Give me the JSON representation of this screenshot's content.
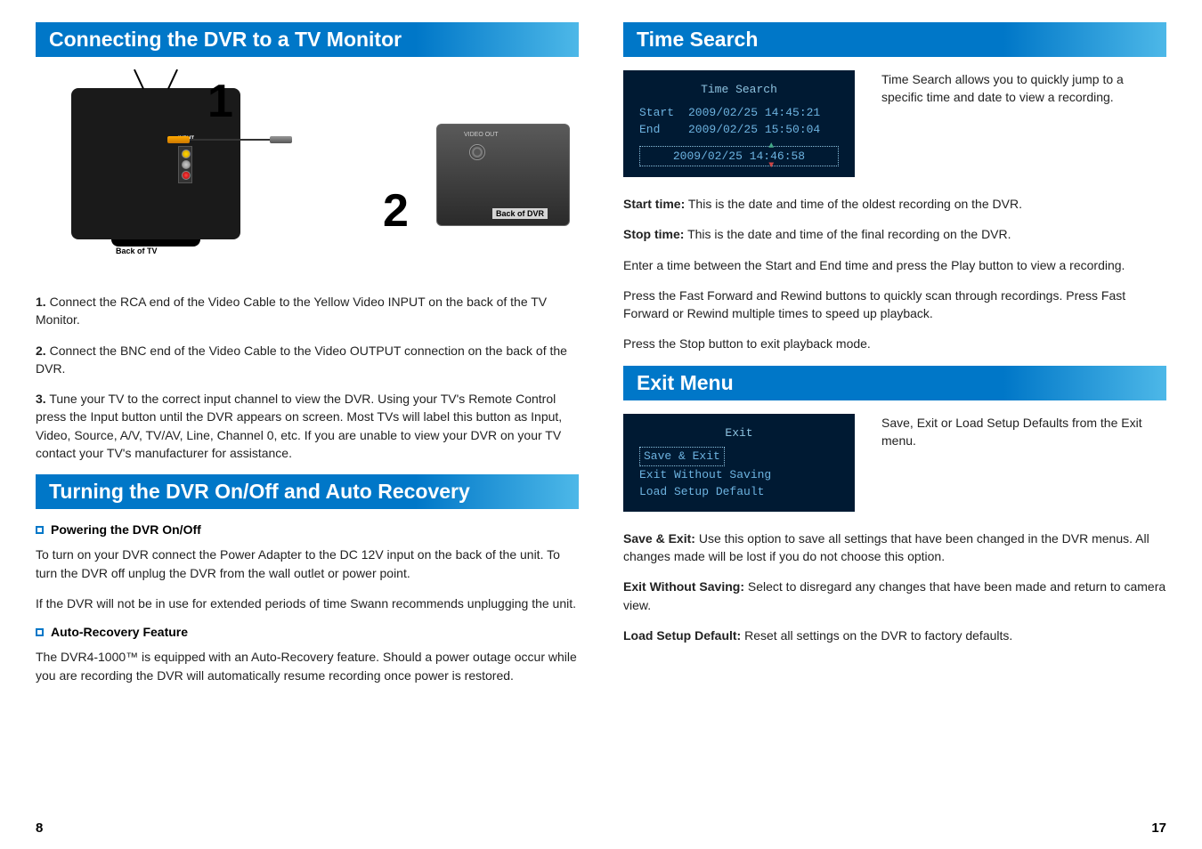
{
  "left": {
    "header1": "Connecting the DVR to a TV Monitor",
    "diagram": {
      "input_label": "INPUT",
      "back_tv": "Back of TV",
      "num1": "1",
      "num2": "2",
      "video_out": "VIDEO OUT",
      "back_dvr": "Back of DVR"
    },
    "step1_label": "1.",
    "step1": "Connect the RCA end of the Video Cable to the Yellow Video INPUT on the back of the TV Monitor.",
    "step2_label": "2.",
    "step2": "Connect the BNC end of the Video Cable to the Video OUTPUT connection on the back of the DVR.",
    "step3_label": "3.",
    "step3": "Tune your TV to the correct input channel to view the DVR.  Using your TV's Remote Control press the Input button until the DVR appears on screen.  Most TVs will label this button as Input, Video, Source, A/V, TV/AV, Line, Channel 0, etc.  If you are unable to view your DVR on your TV contact your TV's manufacturer for assistance.",
    "header2": "Turning the DVR On/Off and Auto Recovery",
    "sub1": "Powering the DVR On/Off",
    "p1": "To turn on your DVR connect the Power Adapter to the DC 12V input on the back of the unit.  To turn the DVR off unplug the DVR from the wall outlet or power point.",
    "p2": "If the DVR will not be in use for extended periods of time Swann recommends unplugging the unit.",
    "sub2": "Auto-Recovery Feature",
    "p3": "The DVR4-1000™ is equipped with an Auto-Recovery feature.  Should a power outage occur while you are recording the DVR will automatically resume recording once power is restored.",
    "page": "8"
  },
  "right": {
    "header1": "Time Search",
    "ts_shot": {
      "title": "Time Search",
      "start_l": "Start",
      "start_v": "2009/02/25 14:45:21",
      "end_l": "End",
      "end_v": "2009/02/25 15:50:04",
      "sel": "2009/02/25 14:46:58"
    },
    "ts_intro": "Time Search allows you to quickly jump to a specific time and date to view a recording.",
    "start_b": "Start time:",
    "start_t": "This is the date and time of the oldest recording on the DVR.",
    "stop_b": "Stop time:",
    "stop_t": "This is the date and time of the final recording on the DVR.",
    "enter": "Enter a time between the Start and End time and press the Play button to view a recording.",
    "ff": "Press the Fast Forward and Rewind buttons to quickly scan through recordings.  Press Fast Forward or Rewind multiple times to speed up playback.",
    "stop": "Press the Stop button to exit playback mode.",
    "header2": "Exit Menu",
    "ex_shot": {
      "title": "Exit",
      "i1": "Save & Exit",
      "i2": "Exit Without Saving",
      "i3": "Load Setup Default"
    },
    "ex_intro": "Save, Exit or Load Setup Defaults from the Exit menu.",
    "se_b": "Save & Exit:",
    "se_t": "Use this option to save all settings that have been changed in the DVR menus.  All changes made will be lost if you do not choose this option.",
    "ew_b": "Exit Without Saving:",
    "ew_t": "Select to disregard any changes that have been made and return to camera view.",
    "ld_b": "Load Setup Default:",
    "ld_t": "Reset all settings on the DVR to factory defaults.",
    "page": "17"
  }
}
